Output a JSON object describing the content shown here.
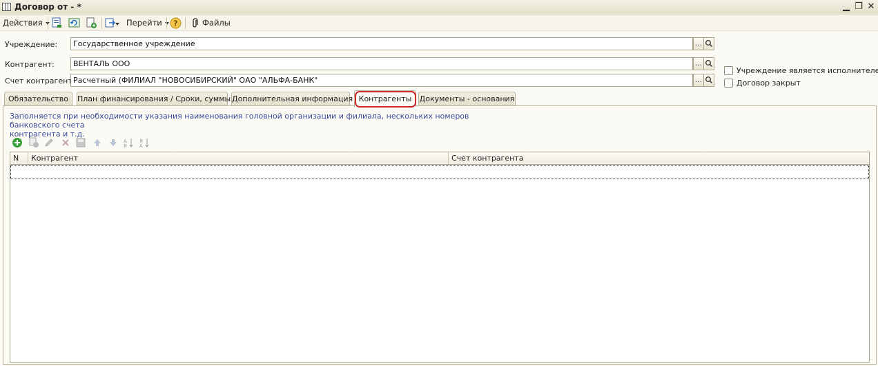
{
  "window": {
    "title": "Договор  от - *",
    "controls": [
      "minimize-icon",
      "restore-icon",
      "close-icon"
    ]
  },
  "toolbar": {
    "actions_label": "Действия",
    "goto_label": "Перейти",
    "files_label": "Файлы",
    "icons": [
      "save-close-icon",
      "refresh-icon",
      "copy-document-icon",
      "post-document-icon",
      "help-icon",
      "paperclip-icon"
    ]
  },
  "form": {
    "institution_label": "Учреждение:",
    "institution_value": "Государственное учреждение",
    "counterparty_label": "Контрагент:",
    "counterparty_value": "ВЕНТАЛЬ ООО",
    "account_label": "Счет контрагента:",
    "account_value": "Расчетный (ФИЛИАЛ \"НОВОСИБИРСКИЙ\" ОАО \"АЛЬФА-БАНК\"",
    "select_button": "...",
    "is_executor_label": "Учреждение является исполнителем",
    "is_executor_checked": false,
    "closed_label": "Договор закрыт",
    "closed_checked": false
  },
  "tabs": [
    {
      "label": "Обязательство",
      "active": false
    },
    {
      "label": "План финансирования / Сроки, суммы",
      "active": false
    },
    {
      "label": "Дополнительная информация",
      "active": false
    },
    {
      "label": "Контрагенты",
      "active": true
    },
    {
      "label": "Документы - основания",
      "active": false
    }
  ],
  "panel": {
    "hint_line1": "Заполняется при необходимости указания наименования головной организации и филиала, нескольких номеров банковского счета",
    "hint_line2": "контрагента и т.д.",
    "table_toolbar_icons": [
      "add-icon",
      "copy-icon",
      "edit-icon",
      "delete-icon",
      "save-icon",
      "move-up-icon",
      "move-down-icon",
      "sort-asc-icon",
      "sort-desc-icon"
    ],
    "columns": [
      "N",
      "Контрагент",
      "Счет контрагента"
    ],
    "rows": []
  },
  "colors": {
    "highlight": "#d1262a",
    "hint_text": "#3a4a9a",
    "background": "#fbfaf4"
  }
}
